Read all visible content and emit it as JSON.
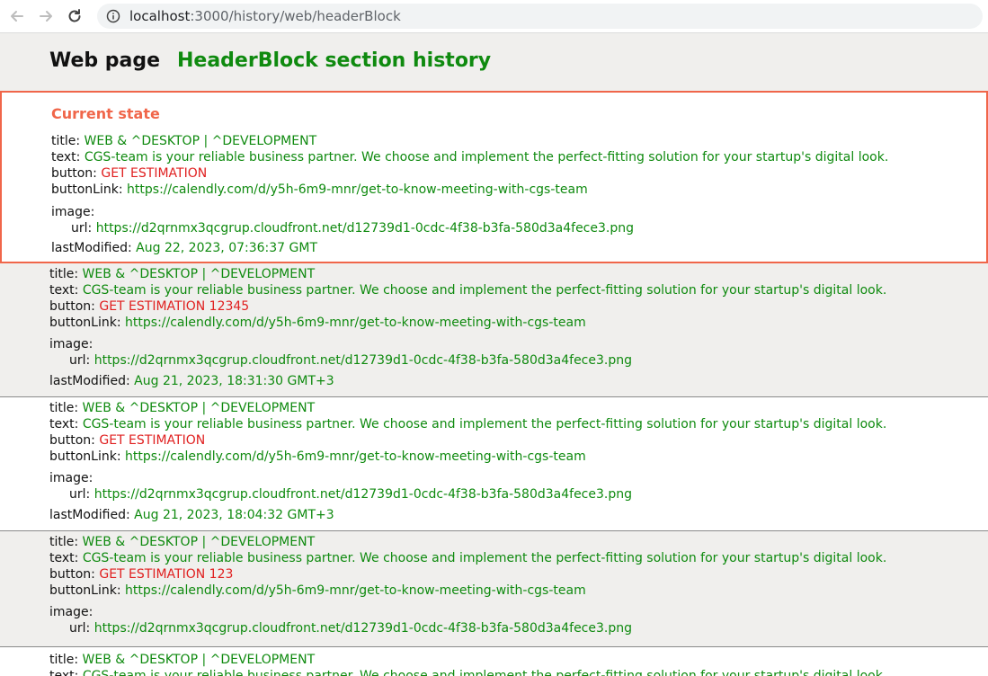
{
  "browser": {
    "url_host": "localhost",
    "url_rest": ":3000/history/web/headerBlock"
  },
  "header": {
    "page_title": "Web page",
    "section_title": "HeaderBlock section history"
  },
  "labels": {
    "title": "title:",
    "text": "text:",
    "button": "button:",
    "buttonLink": "buttonLink:",
    "image": "image:",
    "url": "url:",
    "lastModified": "lastModified:"
  },
  "current": {
    "heading": "Current state",
    "title": "WEB & ^DESKTOP | ^DEVELOPMENT",
    "text": "CGS-team is your reliable business partner. We choose and implement the perfect-fitting solution for your startup's digital look.",
    "button": "GET ESTIMATION",
    "buttonLink": "https://calendly.com/d/y5h-6m9-mnr/get-to-know-meeting-with-cgs-team",
    "image_url": "https://d2qrnmx3qcgrup.cloudfront.net/d12739d1-0cdc-4f38-b3fa-580d3a4fece3.png",
    "lastModified": "Aug 22, 2023, 07:36:37 GMT"
  },
  "history": [
    {
      "title": "WEB & ^DESKTOP | ^DEVELOPMENT",
      "text": "CGS-team is your reliable business partner. We choose and implement the perfect-fitting solution for your startup's digital look.",
      "button": "GET ESTIMATION 12345",
      "buttonLink": "https://calendly.com/d/y5h-6m9-mnr/get-to-know-meeting-with-cgs-team",
      "image_url": "https://d2qrnmx3qcgrup.cloudfront.net/d12739d1-0cdc-4f38-b3fa-580d3a4fece3.png",
      "lastModified": "Aug 21, 2023, 18:31:30 GMT+3"
    },
    {
      "title": "WEB & ^DESKTOP | ^DEVELOPMENT",
      "text": "CGS-team is your reliable business partner. We choose and implement the perfect-fitting solution for your startup's digital look.",
      "button": "GET ESTIMATION",
      "buttonLink": "https://calendly.com/d/y5h-6m9-mnr/get-to-know-meeting-with-cgs-team",
      "image_url": "https://d2qrnmx3qcgrup.cloudfront.net/d12739d1-0cdc-4f38-b3fa-580d3a4fece3.png",
      "lastModified": "Aug 21, 2023, 18:04:32 GMT+3"
    },
    {
      "title": "WEB & ^DESKTOP | ^DEVELOPMENT",
      "text": "CGS-team is your reliable business partner. We choose and implement the perfect-fitting solution for your startup's digital look.",
      "button": "GET ESTIMATION 123",
      "buttonLink": "https://calendly.com/d/y5h-6m9-mnr/get-to-know-meeting-with-cgs-team",
      "image_url": "https://d2qrnmx3qcgrup.cloudfront.net/d12739d1-0cdc-4f38-b3fa-580d3a4fece3.png",
      "lastModified": ""
    },
    {
      "title": "WEB & ^DESKTOP | ^DEVELOPMENT",
      "text": "CGS-team is your reliable business partner. We choose and implement the perfect-fitting solution for your startup's digital look."
    }
  ]
}
